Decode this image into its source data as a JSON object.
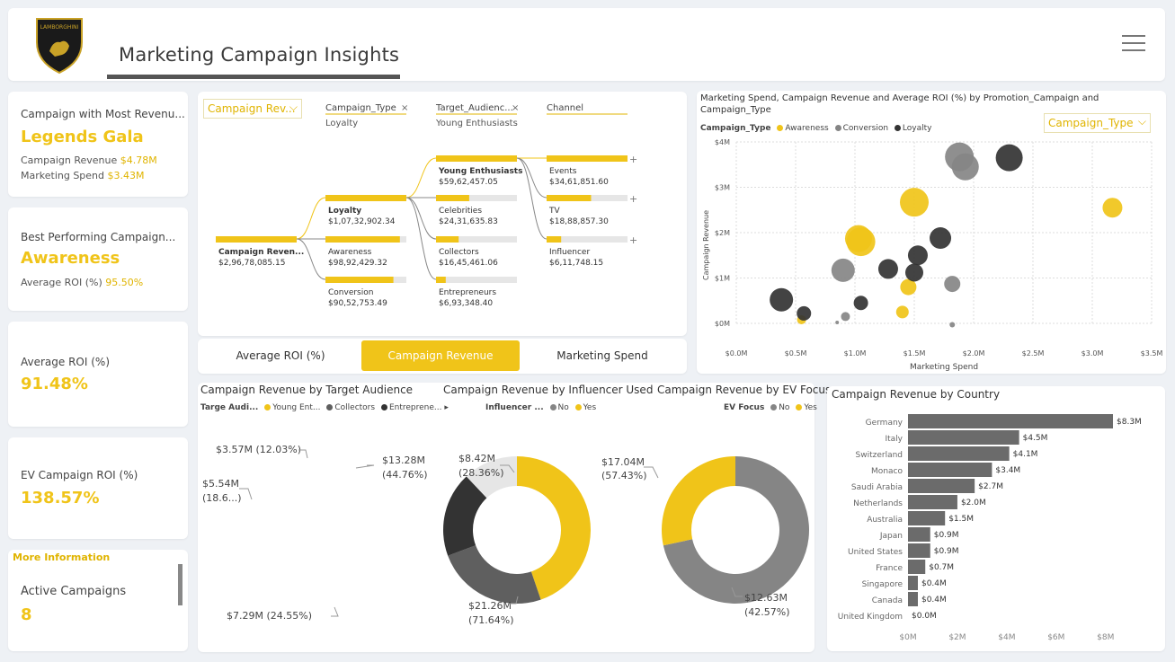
{
  "header": {
    "title": "Marketing Campaign Insights",
    "logo_text": "LAMBORGHINI"
  },
  "kpis": {
    "top_campaign": {
      "label": "Campaign with Most Revenu...",
      "value": "Legends Gala",
      "rev_label": "Campaign Revenue",
      "rev_value": "$4.78M",
      "spend_label": "Marketing Spend",
      "spend_value": "$3.43M"
    },
    "best_campaign": {
      "label": "Best Performing Campaign...",
      "value": "Awareness",
      "roi_label": "Average ROI (%)",
      "roi_value": "95.50%"
    },
    "avg_roi": {
      "label": "Average ROI (%)",
      "value": "91.48%"
    },
    "ev_roi": {
      "label": "EV Campaign ROI (%)",
      "value": "138.57%"
    },
    "more": {
      "title": "More Information",
      "label": "Active Campaigns",
      "value": "8"
    }
  },
  "tree": {
    "dropdown": "Campaign Rev...",
    "levels": [
      {
        "name": "Campaign_Type",
        "filter": "Loyalty"
      },
      {
        "name": "Target_Audienc...",
        "filter": "Young Enthusiasts"
      },
      {
        "name": "Channel",
        "filter": ""
      }
    ],
    "root": {
      "label": "Campaign Reven...",
      "value": "$2,96,78,085.15"
    },
    "types": [
      {
        "label": "Loyalty",
        "value": "$1,07,32,902.34",
        "frac": 1.0
      },
      {
        "label": "Awareness",
        "value": "$98,92,429.32",
        "frac": 0.92
      },
      {
        "label": "Conversion",
        "value": "$90,52,753.49",
        "frac": 0.84
      }
    ],
    "audiences": [
      {
        "label": "Young Enthusiasts",
        "value": "$59,62,457.05",
        "frac": 1.0
      },
      {
        "label": "Celebrities",
        "value": "$24,31,635.83",
        "frac": 0.41
      },
      {
        "label": "Collectors",
        "value": "$16,45,461.06",
        "frac": 0.28
      },
      {
        "label": "Entrepreneurs",
        "value": "$6,93,348.40",
        "frac": 0.12
      }
    ],
    "channels": [
      {
        "label": "Events",
        "value": "$34,61,851.60",
        "frac": 1.0
      },
      {
        "label": "TV",
        "value": "$18,88,857.30",
        "frac": 0.55
      },
      {
        "label": "Influencer",
        "value": "$6,11,748.15",
        "frac": 0.18
      }
    ]
  },
  "buttons": {
    "roi": "Average ROI (%)",
    "revenue": "Campaign Revenue",
    "spend": "Marketing Spend"
  },
  "colors": {
    "gold": "#f0c419",
    "dark": "#333333",
    "mid": "#5f5f5f",
    "gray": "#858585",
    "light": "#e6e6e6",
    "bar": "#6b6b6b"
  },
  "scatter": {
    "title": "Marketing Spend, Campaign Revenue and Average ROI (%) by Promotion_Campaign and Campaign_Type",
    "dropdown": "Campaign_Type",
    "legend_title": "Campaign_Type",
    "legend": [
      "Awareness",
      "Conversion",
      "Loyalty"
    ],
    "xlabel": "Marketing Spend",
    "ylabel": "Campaign Revenue",
    "xticks": [
      "$0.0M",
      "$0.5M",
      "$1.0M",
      "$1.5M",
      "$2.0M",
      "$2.5M",
      "$3.0M",
      "$3.5M"
    ],
    "yticks": [
      "$0M",
      "$1M",
      "$2M",
      "$3M",
      "$4M"
    ]
  },
  "chart_data": [
    {
      "type": "scatter",
      "title": "Marketing Spend, Campaign Revenue and Average ROI (%) by Promotion_Campaign and Campaign_Type",
      "xlabel": "Marketing Spend",
      "ylabel": "Campaign Revenue",
      "xlim": [
        0,
        3.5
      ],
      "ylim": [
        0,
        4
      ],
      "series": [
        {
          "name": "Awareness",
          "points": [
            [
              1.5,
              2.67,
              16
            ],
            [
              1.05,
              1.8,
              16
            ],
            [
              1.03,
              1.87,
              15
            ],
            [
              3.17,
              2.55,
              11
            ],
            [
              1.45,
              0.8,
              9
            ],
            [
              1.4,
              0.25,
              7
            ],
            [
              0.55,
              0.08,
              5
            ]
          ]
        },
        {
          "name": "Conversion",
          "points": [
            [
              1.88,
              3.67,
              16
            ],
            [
              1.93,
              3.45,
              15
            ],
            [
              0.9,
              1.17,
              13
            ],
            [
              1.82,
              0.87,
              9
            ],
            [
              0.92,
              0.15,
              5
            ],
            [
              0.85,
              0.02,
              2
            ],
            [
              1.82,
              -0.03,
              3
            ]
          ]
        },
        {
          "name": "Loyalty",
          "points": [
            [
              2.3,
              3.65,
              15
            ],
            [
              0.38,
              0.52,
              13
            ],
            [
              1.72,
              1.88,
              12
            ],
            [
              1.28,
              1.2,
              11
            ],
            [
              1.53,
              1.5,
              11
            ],
            [
              1.5,
              1.12,
              10
            ],
            [
              1.05,
              0.45,
              8
            ],
            [
              0.57,
              0.22,
              8
            ]
          ]
        }
      ]
    },
    {
      "type": "pie",
      "title": "Campaign Revenue by Target Audience",
      "legend_title": "Targe Audi...",
      "legend": [
        "Young Ent...",
        "Collectors",
        "Entreprene..."
      ],
      "slices": [
        {
          "value": 13.28,
          "label": "$13.28M",
          "pct": "(44.76%)"
        },
        {
          "value": 7.29,
          "label": "$7.29M (24.55%)"
        },
        {
          "value": 5.54,
          "label": "$5.54M",
          "pct": "(18.6...)"
        },
        {
          "value": 3.57,
          "label": "$3.57M (12.03%)"
        }
      ]
    },
    {
      "type": "pie",
      "title": "Campaign Revenue by Influencer Used",
      "legend_title": "Influencer ...",
      "legend": [
        "No",
        "Yes"
      ],
      "slices": [
        {
          "value": 21.26,
          "label": "$21.26M",
          "pct": "(71.64%)"
        },
        {
          "value": 8.42,
          "label": "$8.42M",
          "pct": "(28.36%)"
        }
      ]
    },
    {
      "type": "pie",
      "title": "Campaign Revenue by EV Focus",
      "legend_title": "EV Focus",
      "legend": [
        "No",
        "Yes"
      ],
      "slices": [
        {
          "value": 17.04,
          "label": "$17.04M",
          "pct": "(57.43%)"
        },
        {
          "value": 12.63,
          "label": "$12.63M",
          "pct": "(42.57%)"
        }
      ]
    },
    {
      "type": "bar",
      "title": "Campaign Revenue by Country",
      "categories": [
        "Germany",
        "Italy",
        "Switzerland",
        "Monaco",
        "Saudi Arabia",
        "Netherlands",
        "Australia",
        "Japan",
        "United States",
        "France",
        "Singapore",
        "Canada",
        "United Kingdom"
      ],
      "values": [
        8.3,
        4.5,
        4.1,
        3.4,
        2.7,
        2.0,
        1.5,
        0.9,
        0.9,
        0.7,
        0.4,
        0.4,
        0.0
      ],
      "labels": [
        "$8.3M",
        "$4.5M",
        "$4.1M",
        "$3.4M",
        "$2.7M",
        "$2.0M",
        "$1.5M",
        "$0.9M",
        "$0.9M",
        "$0.7M",
        "$0.4M",
        "$0.4M",
        "$0.0M"
      ],
      "xticks": [
        "$0M",
        "$2M",
        "$4M",
        "$6M",
        "$8M"
      ],
      "xlim": [
        0,
        8.3
      ]
    }
  ]
}
